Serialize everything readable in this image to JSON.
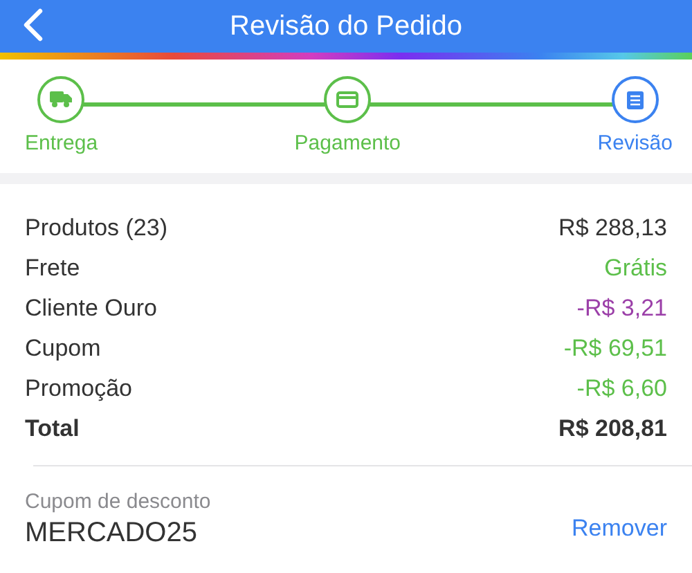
{
  "header": {
    "title": "Revisão do Pedido"
  },
  "steps": [
    {
      "label": "Entrega",
      "selected": false
    },
    {
      "label": "Pagamento",
      "selected": false
    },
    {
      "label": "Revisão",
      "selected": true
    }
  ],
  "summary": [
    {
      "label": "Produtos (23)",
      "value": "R$ 288,13",
      "kind": "normal"
    },
    {
      "label": "Frete",
      "value": "Grátis",
      "kind": "free"
    },
    {
      "label": "Cliente Ouro",
      "value": "-R$ 3,21",
      "kind": "member"
    },
    {
      "label": "Cupom",
      "value": "-R$ 69,51",
      "kind": "discount"
    },
    {
      "label": "Promoção",
      "value": "-R$ 6,60",
      "kind": "discount"
    },
    {
      "label": "Total",
      "value": "R$ 208,81",
      "kind": "total"
    }
  ],
  "coupon": {
    "label": "Cupom de desconto",
    "code": "MERCADO25",
    "action": "Remover"
  }
}
